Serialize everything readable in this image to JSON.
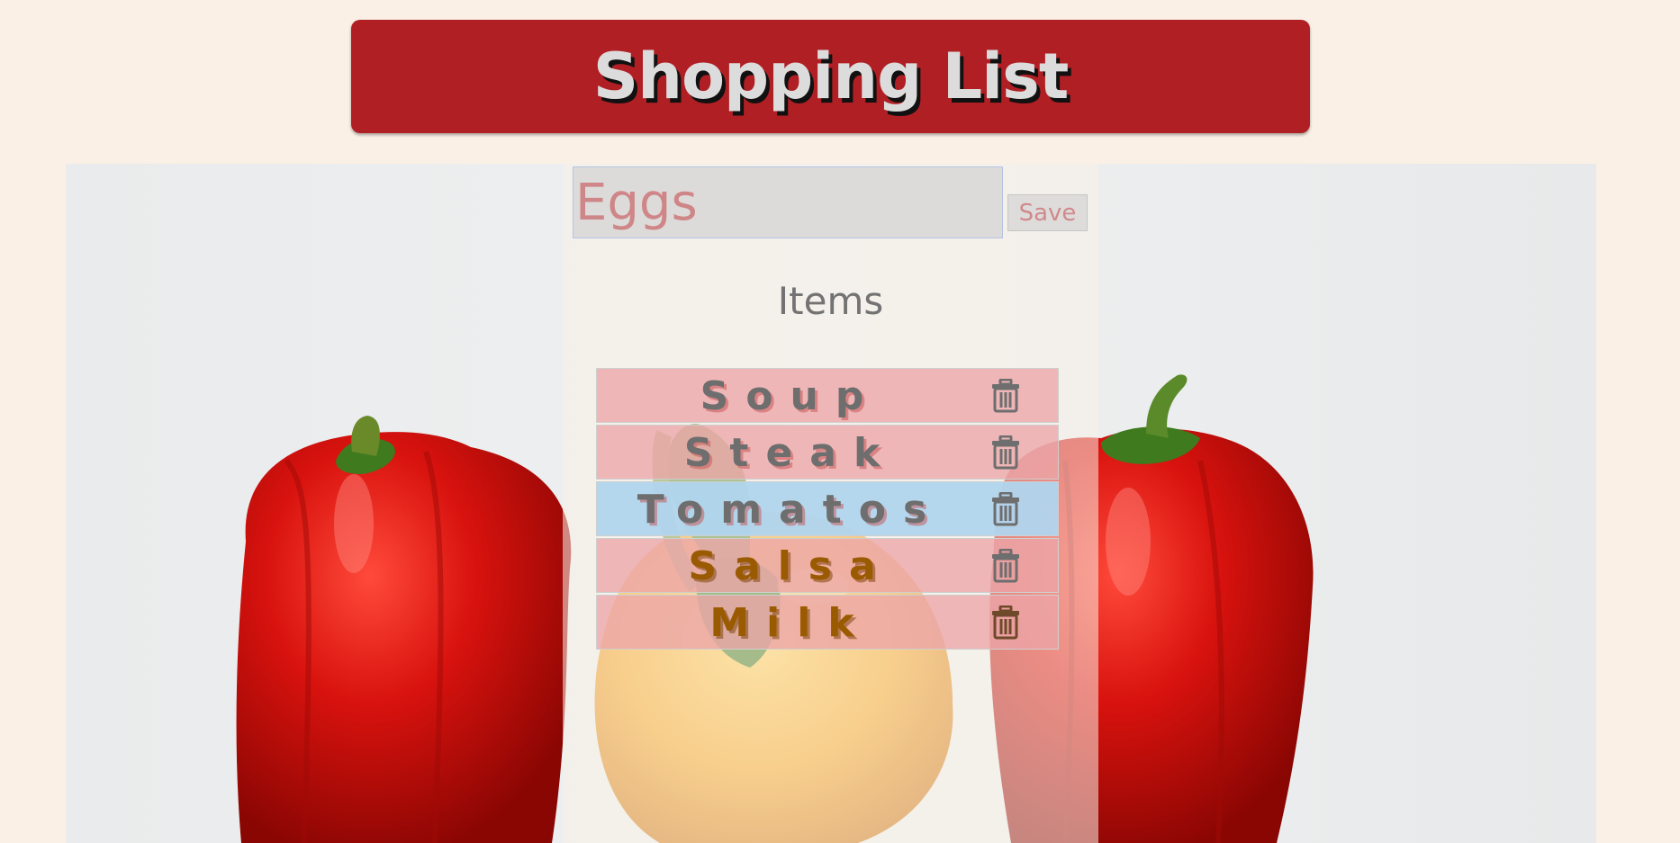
{
  "header": {
    "title": "Shopping List"
  },
  "form": {
    "input_placeholder": "Eggs",
    "save_label": "Save"
  },
  "list": {
    "heading": "Items",
    "items": [
      {
        "label": "Soup",
        "selected": false
      },
      {
        "label": "Steak",
        "selected": false
      },
      {
        "label": "Tomatos",
        "selected": true
      },
      {
        "label": "Salsa",
        "selected": false
      },
      {
        "label": "Milk",
        "selected": false
      }
    ],
    "delete_icon": "trash-icon"
  },
  "colors": {
    "header_bg": "#b01f24",
    "page_bg": "#faf0e6",
    "item_bg": "#eca5a8",
    "selected_item_bg": "#b0d5ee"
  }
}
